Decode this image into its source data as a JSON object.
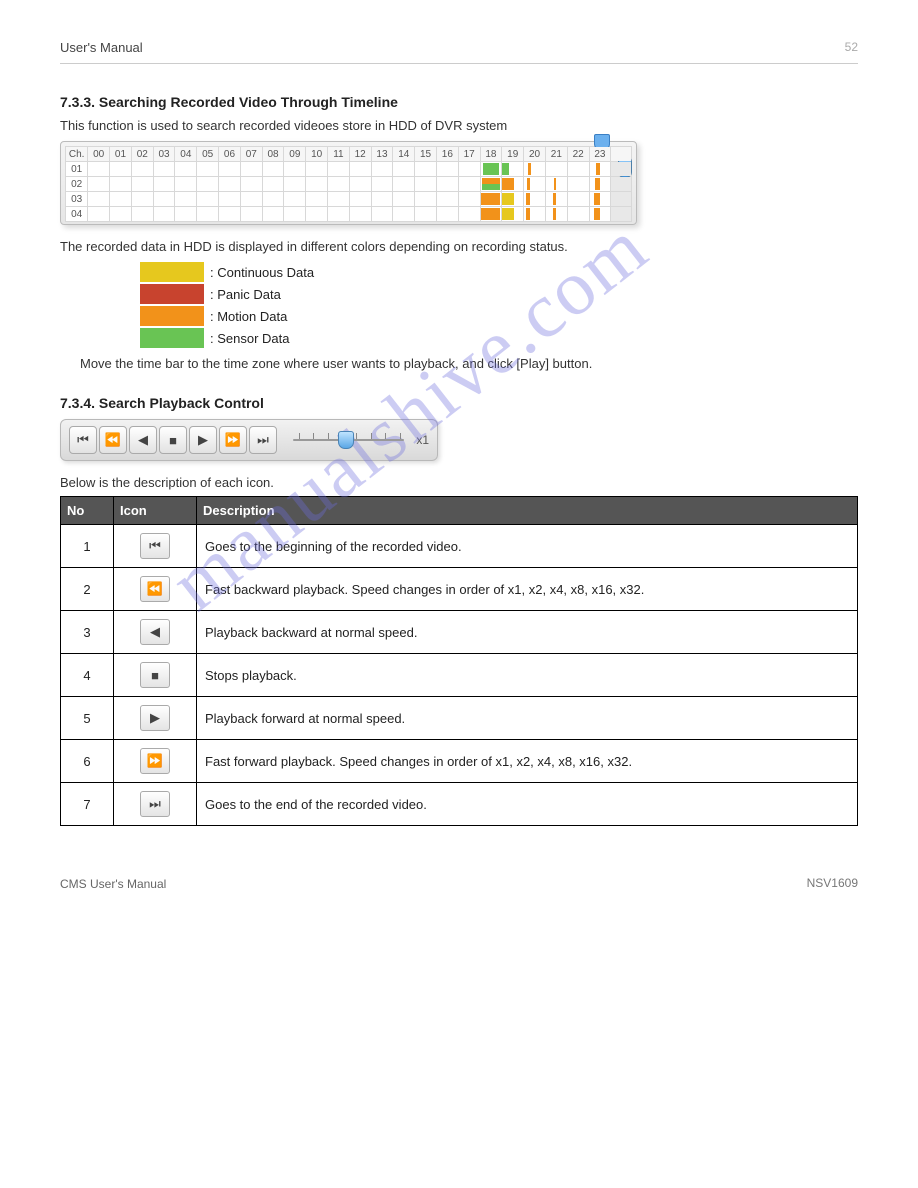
{
  "header": {
    "left": "User's Manual",
    "right": "52"
  },
  "watermark": "manualshive.com",
  "timeline_section": {
    "title": "7.3.3. Searching Recorded Video Through Timeline",
    "intro": "This function is used to search recorded videoes store in HDD of DVR system",
    "ch_label": "Ch.",
    "hours": [
      "00",
      "01",
      "02",
      "03",
      "04",
      "05",
      "06",
      "07",
      "08",
      "09",
      "10",
      "11",
      "12",
      "13",
      "14",
      "15",
      "16",
      "17",
      "18",
      "19",
      "20",
      "21",
      "22",
      "23"
    ],
    "channels": [
      "01",
      "02",
      "03",
      "04"
    ],
    "afterline": "The recorded data in HDD is displayed in different colors depending on recording status.",
    "legend": [
      {
        "label": ": Continuous Data",
        "swatch": "sw-yellow"
      },
      {
        "label": ": Panic Data",
        "swatch": "sw-red"
      },
      {
        "label": ": Motion Data",
        "swatch": "sw-orange"
      },
      {
        "label": ": Sensor Data",
        "swatch": "sw-green"
      }
    ],
    "note": "Move the time bar to the time zone where user wants to playback, and click [Play] button."
  },
  "playback_section": {
    "title": "7.3.4. Search Playback Control",
    "speed_label": "x1",
    "lead": "Below is the description of each icon.",
    "table_header": {
      "c1": "No",
      "c2": "Icon",
      "c3": "Description"
    },
    "rows": [
      {
        "num": "1",
        "glyph": "⏮",
        "desc": "Goes to the beginning of the recorded video."
      },
      {
        "num": "2",
        "glyph": "⏪",
        "desc": "Fast backward playback. Speed changes in order of x1, x2, x4, x8, x16, x32."
      },
      {
        "num": "3",
        "glyph": "◀",
        "desc": "Playback backward at normal speed."
      },
      {
        "num": "4",
        "glyph": "■",
        "desc": "Stops playback."
      },
      {
        "num": "5",
        "glyph": "▶",
        "desc": "Playback forward at normal speed."
      },
      {
        "num": "6",
        "glyph": "⏩",
        "desc": "Fast forward playback. Speed changes in order of x1, x2, x4, x8, x16, x32."
      },
      {
        "num": "7",
        "glyph": "⏭",
        "desc": "Goes to the end of the recorded video."
      }
    ]
  },
  "footer": {
    "left": "CMS User's Manual",
    "right": "NSV1609"
  }
}
